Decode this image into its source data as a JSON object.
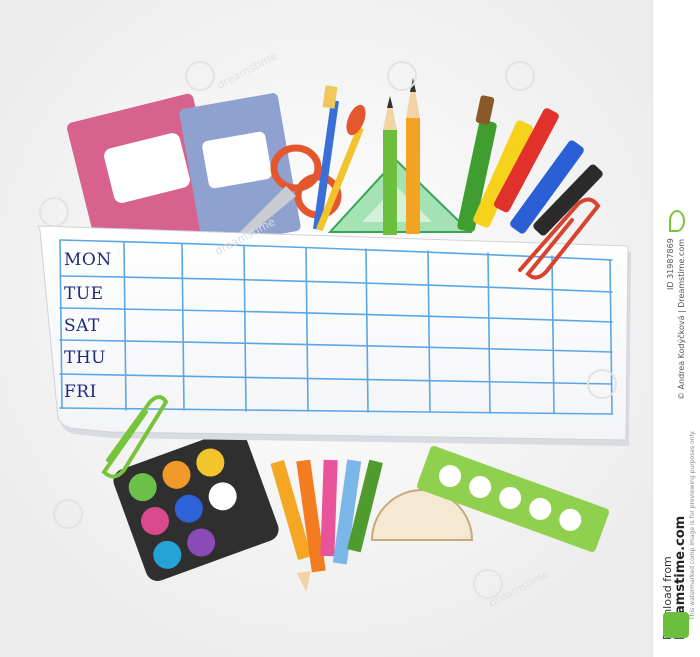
{
  "timetable": {
    "days": [
      "MON",
      "TUE",
      "SAT",
      "THU",
      "FRI"
    ]
  },
  "watermark": {
    "id_label": "ID",
    "id_number": "31987869",
    "copyright_symbol": "©",
    "author": "Andrea Kodýčková | Dreamstime.com",
    "notice": "This watermarked comp image is for previewing purposes only.",
    "download_from": "Download from",
    "site": "Dreamstime.com",
    "tiled_mark": "dreamstime"
  },
  "colors": {
    "grid_blue": "#5aa7e6",
    "ink": "#1d2a78",
    "paperclip_red": "#d8432d",
    "paperclip_green": "#77c43a",
    "notebook_pink": "#d8628e",
    "notebook_blue": "#8fa2cf"
  }
}
